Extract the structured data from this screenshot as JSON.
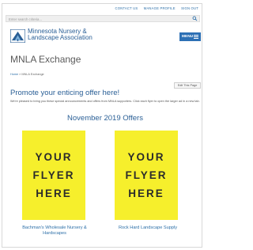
{
  "topnav": {
    "links": [
      "CONTACT US",
      "MANAGE PROFILE",
      "SIGN OUT"
    ]
  },
  "search": {
    "placeholder": "Enter search criteria..."
  },
  "brand": {
    "line1": "Minnesota Nursery &",
    "line2": "Landscape Association"
  },
  "menu": {
    "label": "MENU"
  },
  "page": {
    "title": "MNLA Exchange"
  },
  "breadcrumb": {
    "home": "Home",
    "separator": "»",
    "current": "MNLA Exchange"
  },
  "edit": {
    "label": "Edit This Page"
  },
  "promo": {
    "heading": "Promote your enticing offer here!",
    "body": "We're pleased to bring you these special announcements and offers from MNLA supporters. Click each flyer to open the larger ad in a new tab."
  },
  "offers": {
    "title": "November 2019 Offers",
    "flyers": [
      {
        "text": [
          "YOUR",
          "FLYER",
          "HERE"
        ],
        "caption": "Bachman's Wholesale Nursery & Hardscapes"
      },
      {
        "text": [
          "YOUR",
          "FLYER",
          "HERE"
        ],
        "caption": "Rock Hard Landscape Supply"
      }
    ]
  },
  "colors": {
    "brand_blue": "#2a5f96",
    "menu_blue": "#2d70b5",
    "flyer_yellow": "#f6ef2c"
  }
}
